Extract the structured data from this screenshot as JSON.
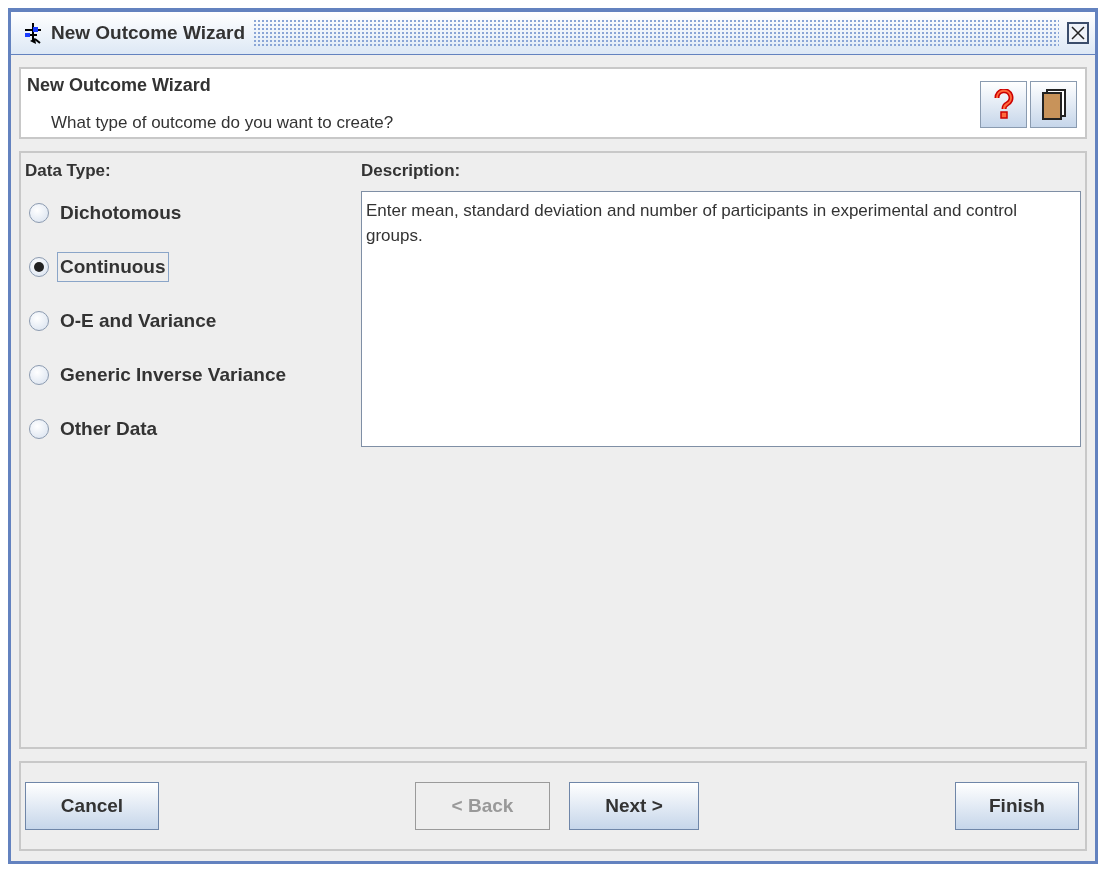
{
  "window": {
    "title": "New Outcome Wizard"
  },
  "header": {
    "title": "New Outcome Wizard",
    "subtitle": "What type of outcome do you want to create?"
  },
  "data_type": {
    "label": "Data Type:",
    "options": [
      {
        "label": "Dichotomous",
        "selected": false
      },
      {
        "label": "Continuous",
        "selected": true
      },
      {
        "label": "O-E and Variance",
        "selected": false
      },
      {
        "label": "Generic Inverse Variance",
        "selected": false
      },
      {
        "label": "Other Data",
        "selected": false
      }
    ]
  },
  "description": {
    "label": "Description:",
    "text": "Enter mean, standard deviation and number of participants in experimental and control groups."
  },
  "buttons": [
    {
      "label": "Cancel",
      "disabled": false
    },
    {
      "label": "< Back",
      "disabled": true
    },
    {
      "label": "Next >",
      "disabled": false
    },
    {
      "label": "Finish",
      "disabled": false
    }
  ]
}
